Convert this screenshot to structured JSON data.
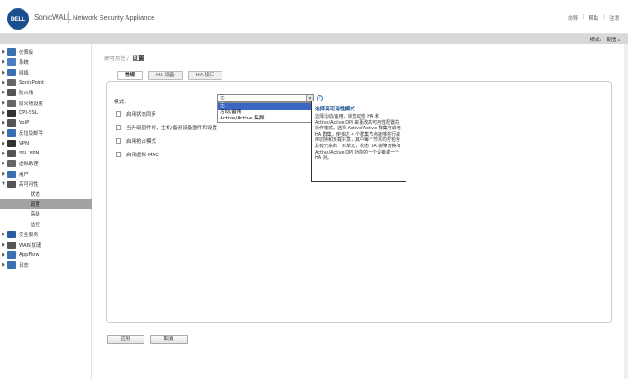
{
  "header": {
    "logo": "DELL",
    "brand": "SonicWALL",
    "product": "Network Security Appliance",
    "links": [
      "向导",
      "帮助",
      "注销"
    ]
  },
  "modebar": {
    "mode_label": "模式:",
    "config_label": "配置 ▸"
  },
  "sidebar": {
    "items": [
      {
        "label": "仪表板",
        "icon": "dashboard-icon",
        "color": "#3a6fb0"
      },
      {
        "label": "系统",
        "icon": "system-icon",
        "color": "#4a80c0"
      },
      {
        "label": "网络",
        "icon": "network-icon",
        "color": "#3a6fb0"
      },
      {
        "label": "SonicPoint",
        "icon": "sonicpoint-icon",
        "color": "#666"
      },
      {
        "label": "防火墙",
        "icon": "firewall-icon",
        "color": "#555"
      },
      {
        "label": "防火墙设置",
        "icon": "firewall-settings-icon",
        "color": "#666"
      },
      {
        "label": "DPI-SSL",
        "icon": "dpi-ssl-icon",
        "color": "#333"
      },
      {
        "label": "VoIP",
        "icon": "voip-icon",
        "color": "#555"
      },
      {
        "label": "反垃圾邮件",
        "icon": "antispam-icon",
        "color": "#3a6fb0"
      },
      {
        "label": "VPN",
        "icon": "vpn-icon",
        "color": "#333"
      },
      {
        "label": "SSL VPN",
        "icon": "ssl-vpn-icon",
        "color": "#555"
      },
      {
        "label": "虚拟助理",
        "icon": "virtual-assist-icon",
        "color": "#666"
      },
      {
        "label": "用户",
        "icon": "users-icon",
        "color": "#3a6fb0"
      },
      {
        "label": "高可用性",
        "icon": "high-availability-icon",
        "color": "#555"
      }
    ],
    "sub_items": [
      "状态",
      "设置",
      "高级",
      "监控"
    ],
    "items_after": [
      {
        "label": "安全服务",
        "icon": "security-services-icon",
        "color": "#2a5aa0"
      },
      {
        "label": "WAN 加速",
        "icon": "wan-acceleration-icon",
        "color": "#555"
      },
      {
        "label": "AppFlow",
        "icon": "appflow-icon",
        "color": "#3a6fb0"
      },
      {
        "label": "日志",
        "icon": "log-icon",
        "color": "#3a6fb0"
      }
    ]
  },
  "breadcrumb": {
    "parent": "高可用性 /",
    "current": "设置"
  },
  "tabs": [
    "常规",
    "HA 设备",
    "HA 接口"
  ],
  "form": {
    "mode_label": "模式:",
    "mode_value": "无",
    "options": [
      "无",
      "活动/备用",
      "Active/Active 集群"
    ],
    "checkboxes": [
      "启用状态同步",
      "当升级固件时，主机/备用设备固件和设置",
      "启用抢占模式",
      "启用虚拟 MAC"
    ]
  },
  "tooltip": {
    "title": "选择高可用性模式",
    "body": "选择活动/备用、状态动态 HA 和 Active/Active DPI 来更改高可用性配置的操作模式。选择 Active/Active 群集可启用 HA 群集，使多达 4 个群集节点能够进行故障切换和负载共享，其中每个节点均可包含具有冗余的一对单元，状态 HA 故障切换和 Active/Active DPI 功能的一个设备或一个 HA 对。"
  },
  "buttons": {
    "apply": "应用",
    "cancel": "取消"
  }
}
